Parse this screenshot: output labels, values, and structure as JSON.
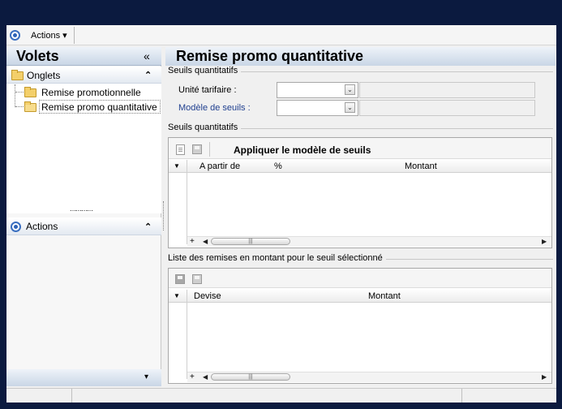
{
  "toolbar": {
    "actions_label": "Actions ▾"
  },
  "left_panel": {
    "title": "Volets",
    "collapse_glyph": "«",
    "onglets": {
      "label": "Onglets",
      "toggle_glyph": "⌃",
      "items": [
        {
          "label": "Remise promotionnelle"
        },
        {
          "label": "Remise promo quantitative"
        }
      ]
    },
    "actions": {
      "label": "Actions",
      "toggle_glyph": "⌃"
    },
    "splitter_glyph": "⋯⋯⋯⋯",
    "bottom_glyph": "▾"
  },
  "main": {
    "title": "Remise promo quantitative",
    "seuils_group": {
      "label": "Seuils quantitatifs",
      "unite_label": "Unité tarifaire :",
      "modele_label": "Modèle de seuils :",
      "unite_value": "",
      "modele_value": ""
    },
    "seuils_grid": {
      "group_label": "Seuils quantitatifs",
      "apply_label": "Appliquer le modèle de seuils",
      "columns": [
        "A partir de",
        "%",
        "Montant"
      ],
      "rows": []
    },
    "remises_grid": {
      "group_label": "Liste des remises en montant pour le seuil sélectionné",
      "columns": [
        "Devise",
        "Montant"
      ],
      "rows": []
    },
    "grid_controls": {
      "add_glyph": "+",
      "left_glyph": "◀",
      "right_glyph": "▶",
      "thumb_glyph": "|||",
      "menu_glyph": "▼"
    }
  },
  "colors": {
    "background": "#0b1a3f",
    "accent": "#2f64b8",
    "panel": "#f0f0f0",
    "header_gradient_end": "#c9d6e6"
  }
}
